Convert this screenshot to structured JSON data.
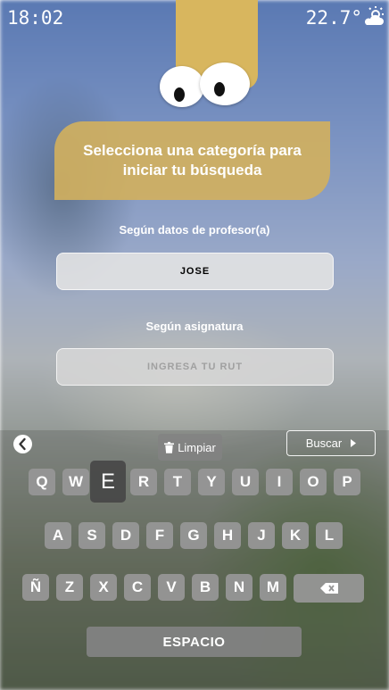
{
  "status": {
    "time": "18:02",
    "temperature": "22.7°",
    "weather_icon": "partly-cloudy-icon"
  },
  "prompt": {
    "title": "Selecciona una categoría para iniciar tu búsqueda"
  },
  "professor_section": {
    "label": "Según datos de profesor(a)",
    "input_value": "JOSE"
  },
  "subject_section": {
    "label": "Según asignatura",
    "placeholder": "INGRESA TU RUT"
  },
  "toolbar": {
    "back_icon": "chevron-left-icon",
    "clear_label": "Limpiar",
    "clear_icon": "trash-icon",
    "search_label": "Buscar",
    "search_icon": "caret-right-icon"
  },
  "keyboard": {
    "row1": [
      "Q",
      "W",
      "E",
      "R",
      "T",
      "Y",
      "U",
      "I",
      "O",
      "P"
    ],
    "row2": [
      "A",
      "S",
      "D",
      "F",
      "G",
      "H",
      "J",
      "K",
      "L"
    ],
    "row3": [
      "Ñ",
      "Z",
      "X",
      "C",
      "V",
      "B",
      "N",
      "M"
    ],
    "backspace_icon": "backspace-icon",
    "pressed_key": "E",
    "space_label": "ESPACIO"
  },
  "colors": {
    "accent": "#d3b05d",
    "key": "#969696",
    "key_pressed": "#464646"
  }
}
